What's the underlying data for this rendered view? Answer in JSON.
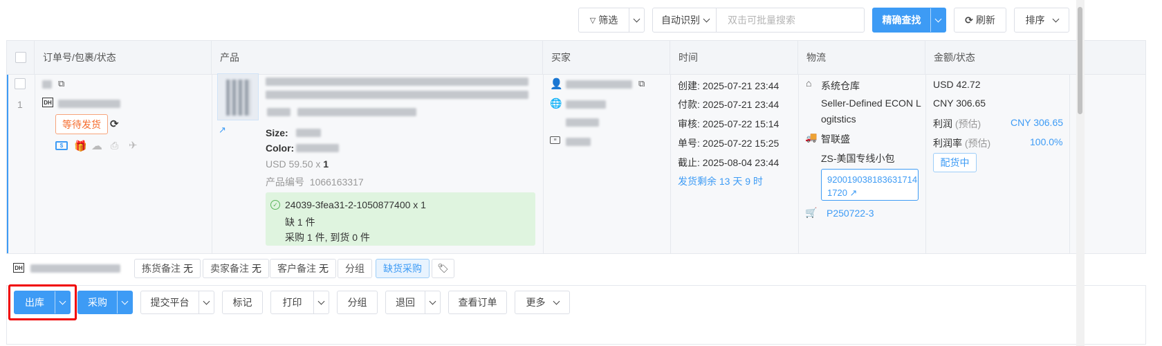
{
  "toolbar": {
    "filter_label": "筛选",
    "search_mode_label": "自动识别",
    "search_placeholder": "双击可批量搜索",
    "search_value": "",
    "exact_search_label": "精确查找",
    "refresh_label": "刷新",
    "sort_label": "排序"
  },
  "table": {
    "headers": [
      "订单号/包裹/状态",
      "产品",
      "买家",
      "时间",
      "物流",
      "金额/状态"
    ]
  },
  "order": {
    "index": "1",
    "status_tag": "等待发货",
    "carrier_badge": "DH",
    "product": {
      "size_label": "Size:",
      "color_label": "Color:",
      "price": "USD 59.50 x",
      "qty": "1",
      "product_no_label": "产品编号",
      "product_no": "1066163317",
      "sku_line": "24039-3fea31-2-1050877400 x 1",
      "shortage_line": "缺 1 件",
      "purchase_line": "采购 1 件, 到货 0 件"
    },
    "time": {
      "created": "创建:  2025-07-21 23:44",
      "paid": "付款:  2025-07-21 23:44",
      "reviewed": "审核:  2025-07-22 15:14",
      "numbered": "单号:  2025-07-22 15:25",
      "deadline": "截止:  2025-08-04 23:44",
      "remaining": "发货剩余 13 天 9 时"
    },
    "logistics": {
      "warehouse": "系统仓库",
      "warehouse_detail_1": "Seller-Defined ECON L",
      "warehouse_detail_2": "ogitstics",
      "carrier": "智联盛",
      "service": "ZS-美国专线小包",
      "tracking_1": "920019038183631714",
      "tracking_2": "1720",
      "purchase_no": "P250722-3"
    },
    "amount": {
      "usd": "USD 42.72",
      "cny": "CNY 306.65",
      "profit_label": "利润",
      "profit_est": "(预估)",
      "profit_value": "CNY 306.65",
      "margin_label": "利润率",
      "margin_est": "(预估)",
      "margin_value": "100.0%",
      "status_button": "配货中"
    }
  },
  "notes": {
    "pick_note": "拣货备注",
    "pick_value": "无",
    "seller_note": "卖家备注",
    "seller_value": "无",
    "customer_note": "客户备注",
    "customer_value": "无",
    "group": "分组",
    "shortage_purchase": "缺货采购"
  },
  "actions": {
    "ship_out": "出库",
    "purchase": "采购",
    "submit_platform": "提交平台",
    "mark": "标记",
    "print": "打印",
    "group": "分组",
    "return": "退回",
    "view_order": "查看订单",
    "more": "更多"
  },
  "colors": {
    "primary": "#3d9bf5",
    "status_orange": "#f56c2d",
    "highlight_red": "#f00000",
    "green_bg": "#dff4df"
  }
}
